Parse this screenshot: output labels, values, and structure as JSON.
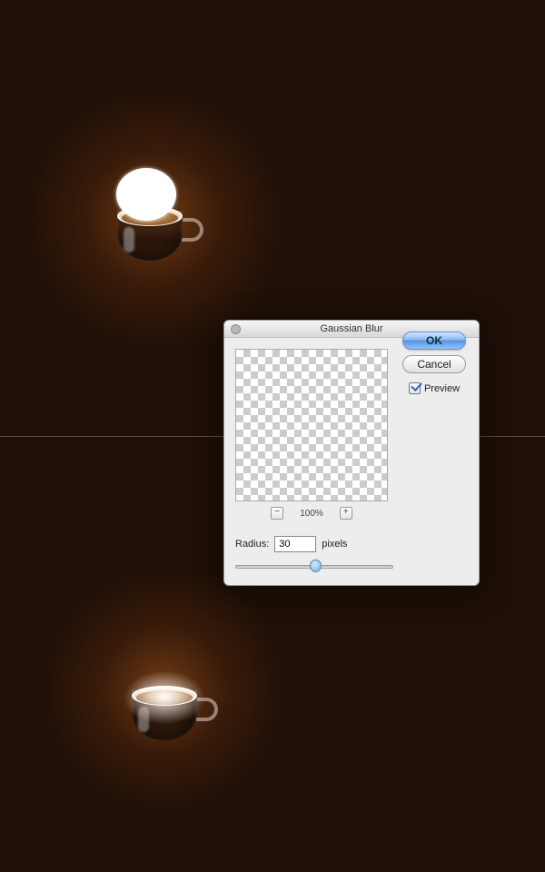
{
  "dialog": {
    "title": "Gaussian Blur",
    "ok_label": "OK",
    "cancel_label": "Cancel",
    "preview_label": "Preview",
    "preview_checked": true,
    "zoom_label": "100%",
    "zoom_out": "−",
    "zoom_in": "+",
    "radius_label": "Radius:",
    "radius_value": "30",
    "radius_unit": "pixels"
  }
}
